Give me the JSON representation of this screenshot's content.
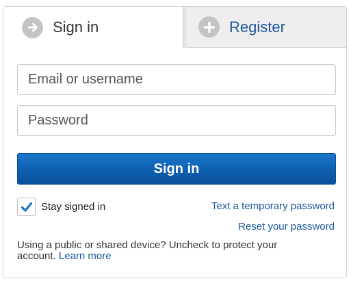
{
  "tabs": {
    "signin": {
      "label": "Sign in",
      "icon": "arrow-right-icon",
      "active": true
    },
    "register": {
      "label": "Register",
      "icon": "plus-icon",
      "active": false
    }
  },
  "form": {
    "email_placeholder": "Email or username",
    "password_placeholder": "Password",
    "submit_label": "Sign in"
  },
  "options": {
    "stay_signed_in_label": "Stay signed in",
    "stay_signed_in_checked": true,
    "temp_password_link": "Text a temporary password",
    "reset_password_link": "Reset your password"
  },
  "notice": {
    "text": "Using a public or shared device? Uncheck to protect your account.",
    "learn_more_link": "Learn more"
  },
  "colors": {
    "accent": "#0d5eae",
    "link": "#1a56a0",
    "checkmark": "#1f74c4",
    "tab_icon_bg": "#c4c4c4"
  }
}
